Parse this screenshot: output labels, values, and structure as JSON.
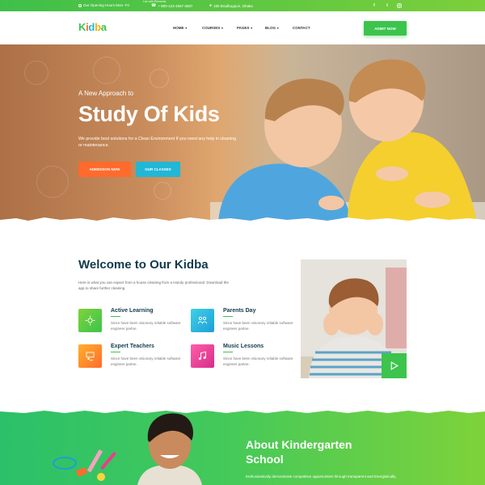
{
  "topbar": {
    "tiny_label": "Lds with Elements",
    "hours": "Our Opening Hours Mon- Fri",
    "phone": "+ 800-123-4567 6587",
    "address": "180 Bradbugaon, Dhaka",
    "social": [
      "f",
      "t",
      "in"
    ]
  },
  "header": {
    "logo_letters": [
      "K",
      "i",
      "d",
      "b",
      "a"
    ],
    "logo_colors": [
      "#3cc44d",
      "#ff6b2c",
      "#22b7d6",
      "#f5b400",
      "#e83e8c"
    ],
    "nav": [
      {
        "label": "HOME",
        "caret": true
      },
      {
        "label": "COURSES",
        "caret": true
      },
      {
        "label": "PAGES",
        "caret": true
      },
      {
        "label": "BLOG",
        "caret": true
      },
      {
        "label": "CONTACT",
        "caret": false
      }
    ],
    "cta": "ADMIT NOW"
  },
  "hero": {
    "subtitle": "A New Approach to",
    "title": "Study Of Kids",
    "description": "We provide best solutions for a Clean Environment If you need any help in cleaning or maintenance.",
    "button_primary": "ADMISSION NOW",
    "button_secondary": "OUR CLASSES"
  },
  "welcome": {
    "title": "Welcome to Our Kidba",
    "description": "Here is what you can expect from a house cleaning from a Handy professional. Download the app to share further cleaning",
    "features": [
      {
        "title": "Active Learning",
        "desc": "Since have been visionary reliable software engineer partne.",
        "icon": "sun-icon"
      },
      {
        "title": "Parents Day",
        "desc": "Since have been visionary reliable software engineer partne.",
        "icon": "family-icon"
      },
      {
        "title": "Expert Teachers",
        "desc": "Since have been visionary reliable software engineer partne.",
        "icon": "teacher-icon"
      },
      {
        "title": "Music Lessons",
        "desc": "Since have been visionary reliable software engineer partne.",
        "icon": "music-icon"
      }
    ]
  },
  "about": {
    "title_line1": "About Kindergarten",
    "title_line2": "School",
    "description": "Enthusiastically demonstrate competitive opportunities through transparent and Energistically."
  },
  "colors": {
    "green": "#3cc44d",
    "orange": "#ff6b2c",
    "teal": "#22b7d6",
    "navy": "#113a4c",
    "pink": "#e83e8c"
  }
}
